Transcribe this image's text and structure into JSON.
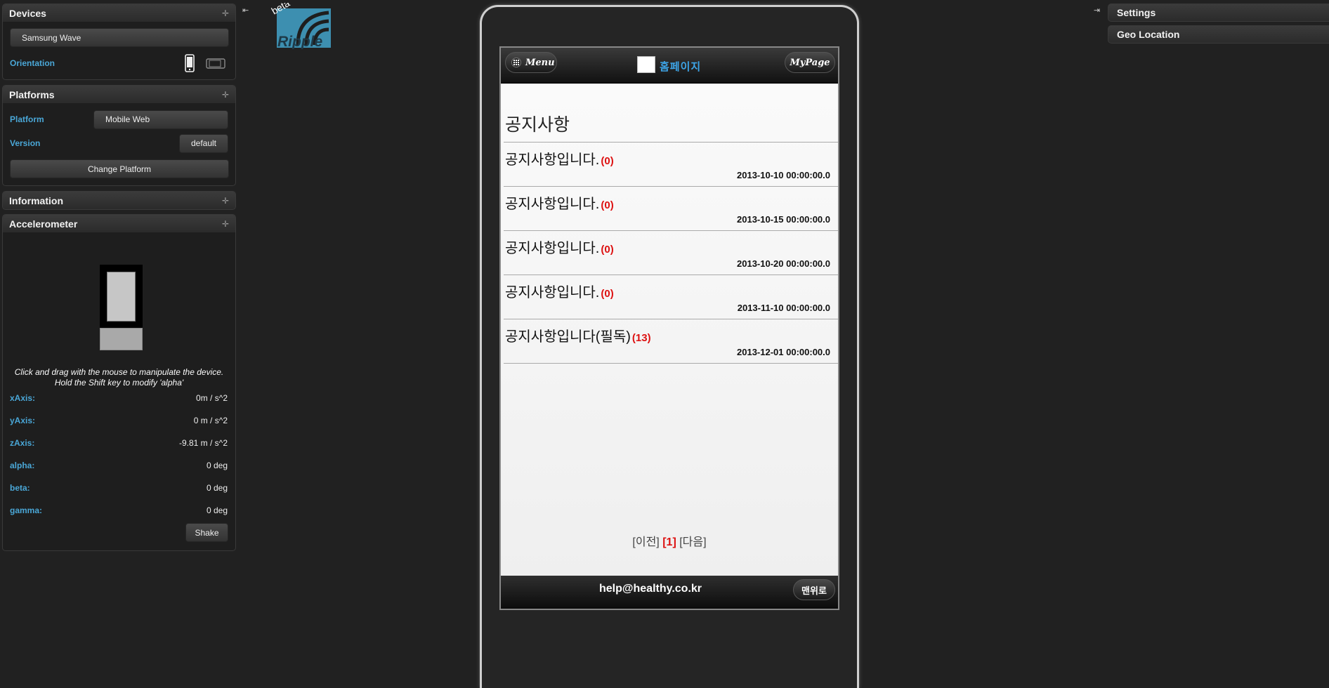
{
  "left_panel": {
    "devices": {
      "title": "Devices",
      "selected_device": "Samsung Wave",
      "orientation_label": "Orientation"
    },
    "platforms": {
      "title": "Platforms",
      "platform_label": "Platform",
      "platform_value": "Mobile Web",
      "version_label": "Version",
      "version_value": "default",
      "change_button": "Change Platform"
    },
    "information": {
      "title": "Information"
    },
    "accelerometer": {
      "title": "Accelerometer",
      "help_line1": "Click and drag with the mouse to manipulate the device.",
      "help_line2": "Hold the Shift key to modify 'alpha'",
      "rows": [
        {
          "label": "xAxis:",
          "value": "0m / s^2"
        },
        {
          "label": "yAxis:",
          "value": "0 m / s^2"
        },
        {
          "label": "zAxis:",
          "value": "-9.81 m / s^2"
        },
        {
          "label": "alpha:",
          "value": "0 deg"
        },
        {
          "label": "beta:",
          "value": "0 deg"
        },
        {
          "label": "gamma:",
          "value": "0 deg"
        }
      ],
      "shake_button": "Shake"
    }
  },
  "logo": {
    "badge": "beta",
    "name": "Ripple"
  },
  "right_panel": {
    "settings_title": "Settings",
    "geo_title": "Geo Location"
  },
  "mobile": {
    "menu_label": "Menu",
    "mypage_label": "MyPage",
    "home_label": "홈페이지",
    "page_title": "공지사항",
    "notices": [
      {
        "title": "공지사항입니다.",
        "count": "(0)",
        "date": "2013-10-10 00:00:00.0"
      },
      {
        "title": "공지사항입니다.",
        "count": "(0)",
        "date": "2013-10-15 00:00:00.0"
      },
      {
        "title": "공지사항입니다.",
        "count": "(0)",
        "date": "2013-10-20 00:00:00.0"
      },
      {
        "title": "공지사항입니다.",
        "count": "(0)",
        "date": "2013-11-10 00:00:00.0"
      },
      {
        "title": "공지사항입니다(필독)",
        "count": "(13)",
        "date": "2013-12-01 00:00:00.0"
      }
    ],
    "pager": {
      "prev": "[이전]",
      "current": "[1]",
      "next": "[다음]"
    },
    "footer_email": "help@healthy.co.kr",
    "top_button": "맨위로"
  },
  "colors": {
    "background": "#212121",
    "label_blue": "#4aa7d7",
    "accent_red": "#dd1111",
    "logo_blue": "#3d8fb0"
  }
}
